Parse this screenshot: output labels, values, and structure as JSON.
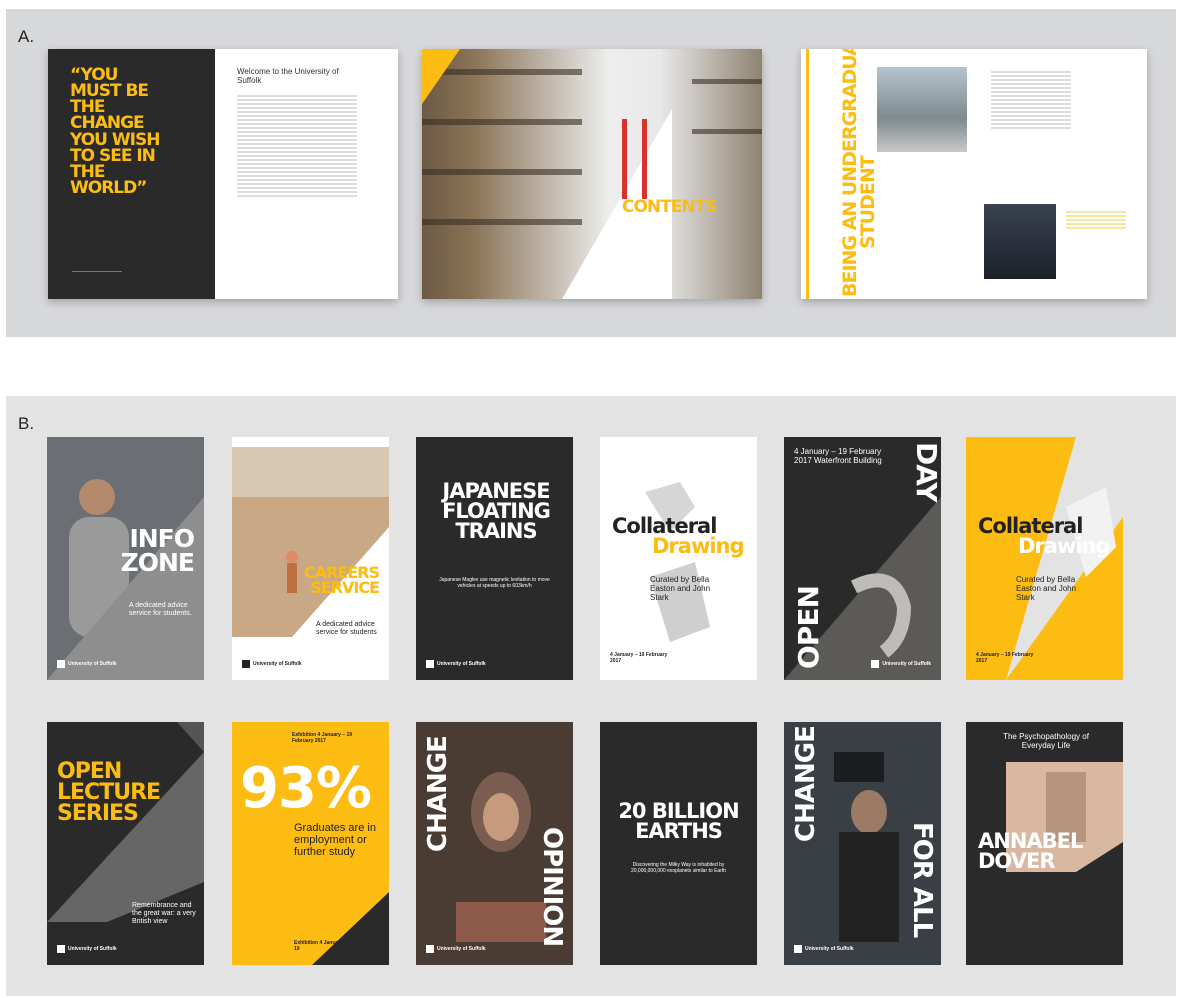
{
  "panel_a": {
    "label": "A.",
    "brochure1": {
      "quote": "“YOU MUST BE THE CHANGE YOU WISH TO SEE IN THE WORLD”",
      "welcome_title": "Welcome to the University of Suffolk"
    },
    "brochure2": {
      "contents_title": "CONTENTS"
    },
    "brochure3": {
      "vertical_title_dark": "BEING AN UNDERGR",
      "vertical_title_yellow": "ADUATE",
      "vertical_title_dark2": "STUDENT"
    }
  },
  "panel_b": {
    "label": "B.",
    "posters_row1": [
      {
        "title1": "INFO",
        "title2": "ZONE",
        "subtitle": "A dedicated advice service for students.",
        "logo": "University of Suffolk"
      },
      {
        "title1": "CAREERS",
        "title2": "SERVICE",
        "subtitle": "A dedicated advice service for students",
        "logo": "University of Suffolk"
      },
      {
        "title": "JAPANESE FLOATING TRAINS",
        "subtitle": "Japanese Maglev use magnetic levitation to move vehicles at speeds up to 603km/h",
        "logo": "University of Suffolk"
      },
      {
        "title1": "Collateral",
        "title2": "Drawing",
        "subtitle": "Curated by Bella Easton and John Stark",
        "date": "4 January – 19 February 2017"
      },
      {
        "date": "4 January – 19 February 2017 Waterfront Building",
        "vert1": "OPEN",
        "vert2": "DAY",
        "logo": "University of Suffolk"
      },
      {
        "title1": "Collateral",
        "title2": "Drawing",
        "subtitle": "Curated by Bella Easton and John Stark",
        "date": "4 January – 19 February 2017"
      }
    ],
    "posters_row2": [
      {
        "title": "OPEN LECTURE SERIES",
        "subtitle": "Remembrance and the great war: a very British view",
        "logo": "University of Suffolk"
      },
      {
        "big": "93%",
        "subtitle": "Graduates are in employment or further study",
        "top": "Exhibition 4 January – 19 February 2017",
        "bottom": "Exhibition 4 January – 19"
      },
      {
        "vert1": "CHANGE",
        "vert2": "OPINION",
        "logo": "University of Suffolk"
      },
      {
        "title": "20 BILLION EARTHS",
        "subtitle": "Discovering the Milky Way is inhabited by 20,000,000,000 exoplanets similar to Earth"
      },
      {
        "vert1": "CHANGE",
        "vert2": "FOR ALL",
        "logo": "University of Suffolk"
      },
      {
        "top": "The Psychopathology of Everyday Life",
        "title": "ANNABEL DOVER"
      }
    ]
  },
  "colors": {
    "brand_yellow": "#fcbc11",
    "brand_dark": "#2b2a2a"
  }
}
